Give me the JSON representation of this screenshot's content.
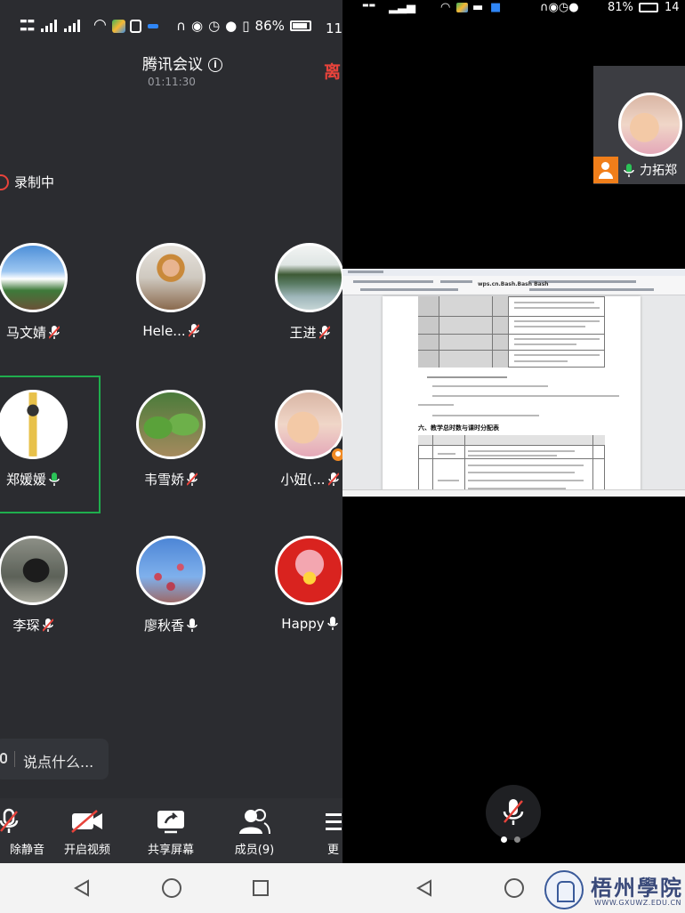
{
  "left_status": {
    "battery_pct": "86%",
    "time": "11"
  },
  "meeting": {
    "title": "腾讯会议",
    "timer": "01:11:30",
    "leave_label": "离",
    "recording_label": "录制中"
  },
  "participants": [
    {
      "name": "马文婧",
      "mic": "muted"
    },
    {
      "name": "Hele...",
      "mic": "muted"
    },
    {
      "name": "王进",
      "mic": "muted"
    },
    {
      "name": "郑媛媛",
      "mic": "on",
      "selected": true
    },
    {
      "name": "韦雪娇",
      "mic": "muted"
    },
    {
      "name": "小妞(...",
      "mic": "muted",
      "badge": true
    },
    {
      "name": "李琛",
      "mic": "muted"
    },
    {
      "name": "廖秋香",
      "mic": "on"
    },
    {
      "name": "Happy",
      "mic": "on"
    }
  ],
  "chat": {
    "placeholder": "说点什么..."
  },
  "toolbar": {
    "unmute_label": "除静音",
    "video_label": "开启视频",
    "share_label": "共享屏幕",
    "members_label": "成员(9)",
    "more_label": "更"
  },
  "right_status": {
    "battery_pct": "81%",
    "time": "14"
  },
  "speaker": {
    "name": "力拓郑"
  },
  "shared_doc": {
    "section_heading": "六、教学总时数与课时分配表",
    "toolbar_title": "wps.cn.Bash.Bash Bash",
    "page_dots": 2,
    "active_page": 0
  },
  "watermark": {
    "cn": "梧州學院",
    "en": "WWW.GXUWZ.EDU.CN"
  },
  "colors": {
    "accent_green": "#1fae4d",
    "leave_red": "#e8433b",
    "host_orange": "#f07e1a",
    "panel_bg": "#2b2c30"
  }
}
